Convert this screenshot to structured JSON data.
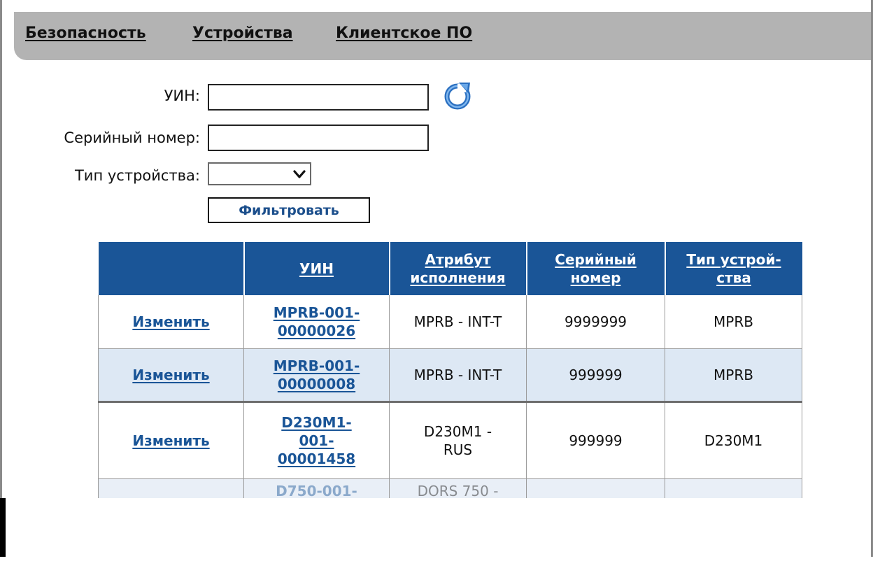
{
  "nav": {
    "items": [
      "Безопасность",
      "Устройства",
      "Клиентское ПО"
    ]
  },
  "filters": {
    "uin_label": "УИН:",
    "uin_value": "",
    "serial_label": "Серийный номер:",
    "serial_value": "",
    "device_type_label": "Тип устройства:",
    "device_type_value": "",
    "filter_button": "Фильтровать"
  },
  "table": {
    "headers": {
      "uin": "УИН",
      "attribute_line1": "Атрибут",
      "attribute_line2": "исполнения",
      "serial_line1": "Серийный",
      "serial_line2": "номер",
      "type_line1": "Тип устрой-",
      "type_line2": "ства"
    },
    "rows": [
      {
        "action": "Изменить",
        "uin_line1": "MPRB-001-",
        "uin_line2": "00000026",
        "attribute": "MPRB - INT-T",
        "serial": "9999999",
        "type": "MPRB"
      },
      {
        "action": "Изменить",
        "uin_line1": "MPRB-001-",
        "uin_line2": "00000008",
        "attribute": "MPRB - INT-T",
        "serial": "999999",
        "type": "MPRB"
      },
      {
        "action": "Изменить",
        "uin_line1": "D230M1-",
        "uin_line2": "001-",
        "uin_line3": "00001458",
        "attribute_line1": "D230M1 -",
        "attribute_line2": "RUS",
        "serial": "999999",
        "type": "D230M1"
      },
      {
        "uin_line1": "D750-001-",
        "attribute_line1": "DORS 750 -"
      }
    ]
  },
  "colors": {
    "header_bg": "#1a5597",
    "link": "#1a5597",
    "nav_bg": "#b3b3b3",
    "alt_row": "#dde8f4"
  },
  "icons": {
    "refresh": "refresh-icon",
    "dropdown": "chevron-down-icon"
  }
}
